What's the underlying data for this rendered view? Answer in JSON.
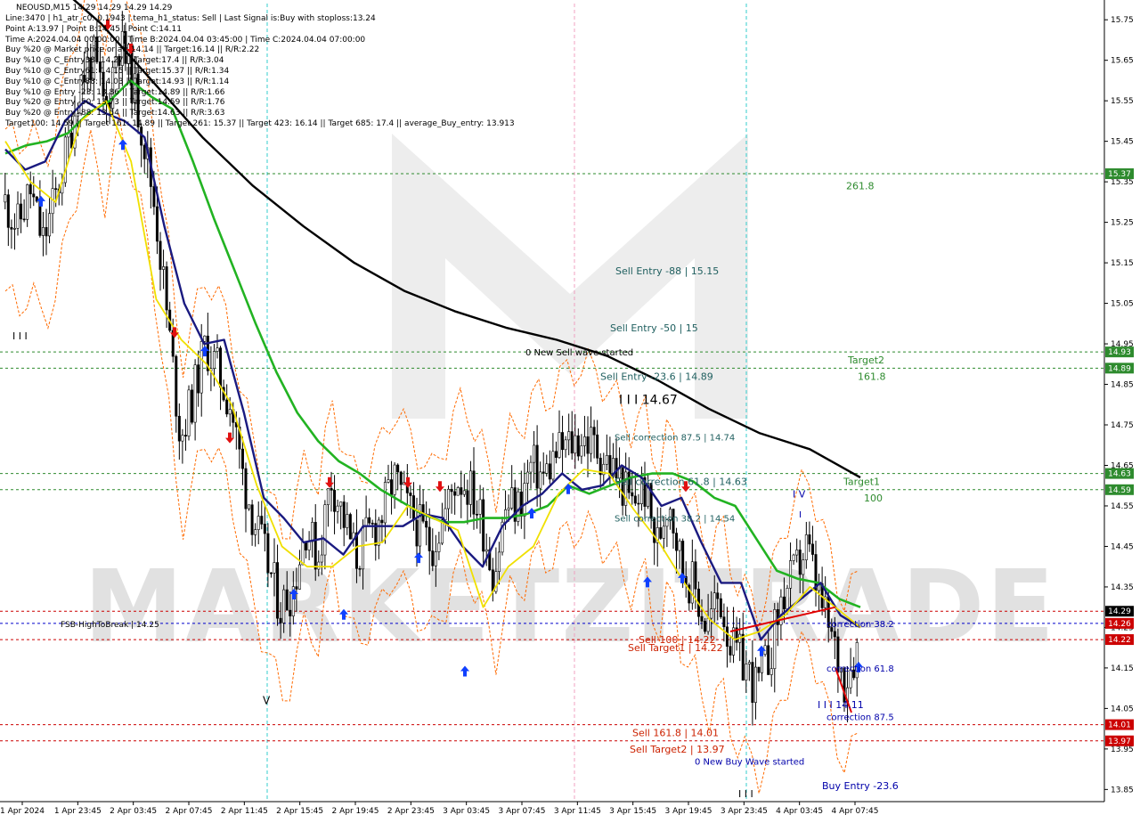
{
  "header": {
    "symbol_line": "NEOUSD,M15  14.29 14.29 14.29 14.29",
    "info_lines": [
      "Line:3470 | h1_atr_c0: 0.1943 | tema_h1_status: Sell | Last Signal is:Buy with stoploss:13.24",
      "Point A:13.97 | Point B:14.45 | Point C:14.11",
      "Time A:2024.04.04 00:00:00 | Time B:2024.04.04 03:45:00 | Time C:2024.04.04 07:00:00",
      "Buy %20 @ Market price or at: 14.14 || Target:16.14 || R/R:2.22",
      "Buy %10 @ C_Entry38: 14.27 || Target:17.4 || R/R:3.04",
      "Buy %10 @ C_Entry61: 14.15 || Target:15.37 || R/R:1.34",
      "Buy %10 @ C_Entry88: 14.03 || Target:14.93 || R/R:1.14",
      "Buy %10 @ Entry -23: 13.86 || Target:14.89 || R/R:1.66",
      "Buy %20 @ Entry -50: 13.73 || Target:14.59 || R/R:1.76",
      "Buy %20 @ Entry -88: 13.54 || Target:14.63 || R/R:3.63",
      "Target100: 14.59 || Target 161: 14.89 || Target 261: 15.37 || Target 423: 16.14 || Target 685: 17.4 || average_Buy_entry: 13.913"
    ]
  },
  "watermark": "MARKETZITRADE",
  "chart_data": {
    "type": "candlestick",
    "symbol": "NEOUSD",
    "timeframe": "M15",
    "ylim": [
      13.82,
      15.79
    ],
    "y_ticks": [
      15.75,
      15.65,
      15.55,
      15.45,
      15.35,
      15.25,
      15.15,
      15.05,
      14.95,
      14.85,
      14.75,
      14.65,
      14.55,
      14.45,
      14.35,
      14.25,
      14.15,
      14.05,
      13.95,
      13.85
    ],
    "x_ticks": [
      "1 Apr 2024",
      "1 Apr 23:45",
      "2 Apr 03:45",
      "2 Apr 07:45",
      "2 Apr 11:45",
      "2 Apr 15:45",
      "2 Apr 19:45",
      "2 Apr 23:45",
      "3 Apr 03:45",
      "3 Apr 07:45",
      "3 Apr 11:45",
      "3 Apr 15:45",
      "3 Apr 19:45",
      "3 Apr 23:45",
      "4 Apr 03:45",
      "4 Apr 07:45"
    ],
    "close_series": [
      15.3,
      15.24,
      15.33,
      15.2,
      15.31,
      15.44,
      15.6,
      15.66,
      15.52,
      15.7,
      15.62,
      15.47,
      15.28,
      15.0,
      14.72,
      14.82,
      14.95,
      14.88,
      14.8,
      14.62,
      14.5,
      14.4,
      14.3,
      14.35,
      14.5,
      14.42,
      14.62,
      14.52,
      14.42,
      14.48,
      14.52,
      14.62,
      14.55,
      14.5,
      14.45,
      14.52,
      14.62,
      14.6,
      14.52,
      14.38,
      14.55,
      14.55,
      14.65,
      14.62,
      14.68,
      14.7,
      14.72,
      14.7,
      14.66,
      14.62,
      14.55,
      14.6,
      14.45,
      14.58,
      14.4,
      14.35,
      14.25,
      14.33,
      14.2,
      14.16,
      14.1,
      14.18,
      14.32,
      14.38,
      14.45,
      14.32,
      14.22,
      14.12,
      14.2
    ],
    "moving_averages": [
      {
        "color": "#000000",
        "values": [
          15.95,
          15.85,
          15.74,
          15.6,
          15.46,
          15.34,
          15.24,
          15.15,
          15.08,
          15.03,
          14.99,
          14.96,
          14.92,
          14.86,
          14.79,
          14.73,
          14.69,
          14.62
        ]
      },
      {
        "color": "#22b322",
        "values": [
          15.42,
          15.44,
          15.45,
          15.47,
          15.52,
          15.55,
          15.6,
          15.56,
          15.53,
          15.4,
          15.26,
          15.13,
          15.0,
          14.88,
          14.78,
          14.71,
          14.66,
          14.63,
          14.59,
          14.56,
          14.53,
          14.51,
          14.51,
          14.52,
          14.52,
          14.53,
          14.55,
          14.6,
          14.58,
          14.6,
          14.62,
          14.63,
          14.63,
          14.61,
          14.57,
          14.55,
          14.47,
          14.39,
          14.37,
          14.36,
          14.32,
          14.3
        ]
      },
      {
        "color": "#1a1a80",
        "values": [
          15.43,
          15.38,
          15.4,
          15.5,
          15.55,
          15.52,
          15.5,
          15.46,
          15.24,
          15.05,
          14.95,
          14.96,
          14.78,
          14.57,
          14.52,
          14.46,
          14.47,
          14.43,
          14.5,
          14.5,
          14.5,
          14.53,
          14.52,
          14.45,
          14.4,
          14.5,
          14.55,
          14.58,
          14.63,
          14.59,
          14.6,
          14.65,
          14.62,
          14.55,
          14.57,
          14.46,
          14.36,
          14.36,
          14.22,
          14.28,
          14.32,
          14.36,
          14.28,
          14.25
        ]
      },
      {
        "color": "#f0e000",
        "values": [
          15.45,
          15.35,
          15.3,
          15.5,
          15.55,
          15.4,
          15.06,
          14.96,
          14.9,
          14.8,
          14.6,
          14.45,
          14.4,
          14.4,
          14.45,
          14.46,
          14.55,
          14.52,
          14.49,
          14.3,
          14.4,
          14.45,
          14.58,
          14.64,
          14.63,
          14.54,
          14.46,
          14.36,
          14.27,
          14.22,
          14.24,
          14.28,
          14.35,
          14.3,
          14.25
        ]
      }
    ],
    "horizontal_levels": [
      {
        "price": 15.37,
        "color": "#2e8b2e",
        "label": "15.37",
        "label_bg": "#2e8b2e"
      },
      {
        "price": 14.93,
        "color": "#2e8b2e",
        "label": "14.93",
        "label_bg": "#2e8b2e"
      },
      {
        "price": 14.89,
        "color": "#2e8b2e",
        "label": "14.89",
        "label_bg": "#2e8b2e"
      },
      {
        "price": 14.63,
        "color": "#2e8b2e",
        "label": "14.63",
        "label_bg": "#2e8b2e"
      },
      {
        "price": 14.59,
        "color": "#2e8b2e",
        "label": "14.59",
        "label_bg": "#2e8b2e"
      },
      {
        "price": 14.29,
        "color": "#cc0000",
        "label": "14.29",
        "label_bg": "#000000"
      },
      {
        "price": 14.26,
        "color": "#0000cc",
        "label": "14.26",
        "label_bg": "#cc0000"
      },
      {
        "price": 14.22,
        "color": "#cc0000",
        "label": "14.22",
        "label_bg": "#cc0000"
      },
      {
        "price": 14.01,
        "color": "#cc0000",
        "label": "14.01",
        "label_bg": "#cc0000"
      },
      {
        "price": 13.97,
        "color": "#cc0000",
        "label": "13.97",
        "label_bg": "#cc0000"
      }
    ],
    "annotations": [
      {
        "text": "261.8",
        "price": 15.34,
        "color": "#2e8b2e"
      },
      {
        "text": "Sell Entry -88 | 15.15",
        "price": 15.13,
        "color": "#1f5f5f"
      },
      {
        "text": "Sell Entry -50 | 15",
        "price": 14.99,
        "color": "#1f5f5f"
      },
      {
        "text": "0 New Sell wave started",
        "price": 14.93,
        "color": "#000000"
      },
      {
        "text": "Target2",
        "price": 14.91,
        "color": "#2e8b2e"
      },
      {
        "text": "Sell Entry -23.6 | 14.89",
        "price": 14.87,
        "color": "#1f5f5f"
      },
      {
        "text": "161.8",
        "price": 14.87,
        "color": "#2e8b2e"
      },
      {
        "text": "I I I 14.67",
        "price": 14.81,
        "color": "#000000"
      },
      {
        "text": "Sell correction 87.5 | 14.74",
        "price": 14.72,
        "color": "#1f5f5f"
      },
      {
        "text": "Target1",
        "price": 14.61,
        "color": "#2e8b2e"
      },
      {
        "text": "Sell correction 61.8 | 14.63",
        "price": 14.61,
        "color": "#1f5f5f"
      },
      {
        "text": "I V",
        "price": 14.58,
        "color": "#0000aa"
      },
      {
        "text": "100",
        "price": 14.57,
        "color": "#2e8b2e"
      },
      {
        "text": "Sell correction 38.2 | 14.54",
        "price": 14.52,
        "color": "#1f5f5f"
      },
      {
        "text": "FSB-HighToBreak | 14.25",
        "price": 14.26,
        "color": "#000000"
      },
      {
        "text": "correction 38.2",
        "price": 14.26,
        "color": "#0000aa"
      },
      {
        "text": "Sell 100 | 14.22",
        "price": 14.22,
        "color": "#cc2200"
      },
      {
        "text": "Sell Target1 | 14.22",
        "price": 14.2,
        "color": "#cc2200"
      },
      {
        "text": "correction 61.8",
        "price": 14.15,
        "color": "#0000aa"
      },
      {
        "text": "I I I 14.11",
        "price": 14.06,
        "color": "#0000aa"
      },
      {
        "text": "correction 87.5",
        "price": 14.03,
        "color": "#0000aa"
      },
      {
        "text": "Sell 161.8 | 14.01",
        "price": 13.99,
        "color": "#cc2200"
      },
      {
        "text": "Sell Target2 | 13.97",
        "price": 13.95,
        "color": "#cc2200"
      },
      {
        "text": "0 New Buy Wave started",
        "price": 13.92,
        "color": "#0000aa"
      },
      {
        "text": "Buy Entry -23.6",
        "price": 13.86,
        "color": "#0000aa"
      },
      {
        "text": "I I I",
        "price": 14.97,
        "color": "#000000"
      },
      {
        "text": "V",
        "price": 14.07,
        "color": "#000000"
      },
      {
        "text": "I I I",
        "price": 13.84,
        "color": "#000000"
      },
      {
        "text": "I",
        "price": 14.53,
        "color": "#0000aa"
      }
    ]
  }
}
